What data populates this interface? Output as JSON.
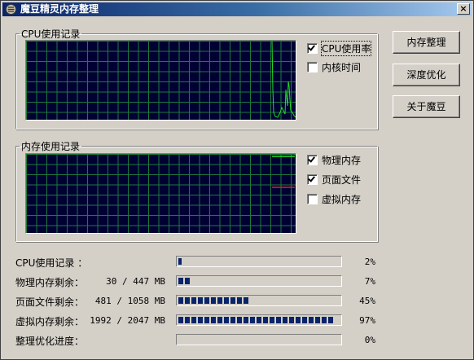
{
  "window": {
    "title": "魔豆精灵内存整理",
    "close_glyph": "×"
  },
  "cpu_group": {
    "legend": "CPU使用记录",
    "options": [
      {
        "label": "CPU使用率",
        "checked": true
      },
      {
        "label": "内核时间",
        "checked": false
      }
    ]
  },
  "mem_group": {
    "legend": "内存使用记录",
    "options": [
      {
        "label": "物理内存",
        "checked": true
      },
      {
        "label": "页面文件",
        "checked": true
      },
      {
        "label": "虚拟内存",
        "checked": false
      }
    ]
  },
  "buttons": {
    "optimize": "内存整理",
    "deep": "深度优化",
    "about": "关于魔豆"
  },
  "stats": [
    {
      "label": "CPU使用记录 ：",
      "amount": "",
      "percent": "2%",
      "fraction": 0.02
    },
    {
      "label": "物理内存剩余：",
      "amount": "30 / 447 MB",
      "percent": "7%",
      "fraction": 0.07
    },
    {
      "label": "页面文件剩余：",
      "amount": "481 / 1058 MB",
      "percent": "45%",
      "fraction": 0.45
    },
    {
      "label": "虚拟内存剩余：",
      "amount": "1992 / 2047 MB",
      "percent": "97%",
      "fraction": 0.97
    },
    {
      "label": "整理优化进度：",
      "amount": "",
      "percent": "0%",
      "fraction": 0.0
    }
  ],
  "colors": {
    "graph_bg": "#000033",
    "grid": "#1e7a3c",
    "cpu_line": "#22dd22",
    "physical_line": "#22dd22",
    "pagefile_line": "#dd2222",
    "bar_fill": "#0a246a"
  }
}
